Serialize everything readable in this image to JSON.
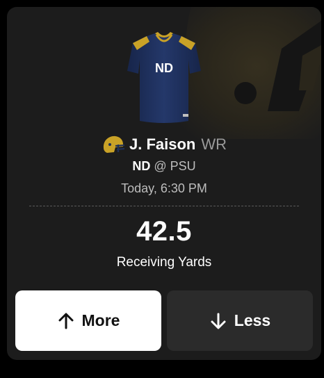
{
  "player": {
    "name": "J. Faison",
    "position": "WR",
    "jersey_text": "ND"
  },
  "game": {
    "team": "ND",
    "separator": "@",
    "opponent": "PSU",
    "time": "Today, 6:30 PM"
  },
  "projection": {
    "line": "42.5",
    "stat": "Receiving Yards"
  },
  "actions": {
    "more_label": "More",
    "more_icon": "arrow-up-icon",
    "less_label": "Less",
    "less_icon": "arrow-down-icon"
  },
  "colors": {
    "card_bg": "#1c1c1c",
    "jersey_navy": "#1f3057",
    "gold": "#c9a227",
    "more_bg": "#ffffff",
    "less_bg": "#2b2b2b"
  }
}
